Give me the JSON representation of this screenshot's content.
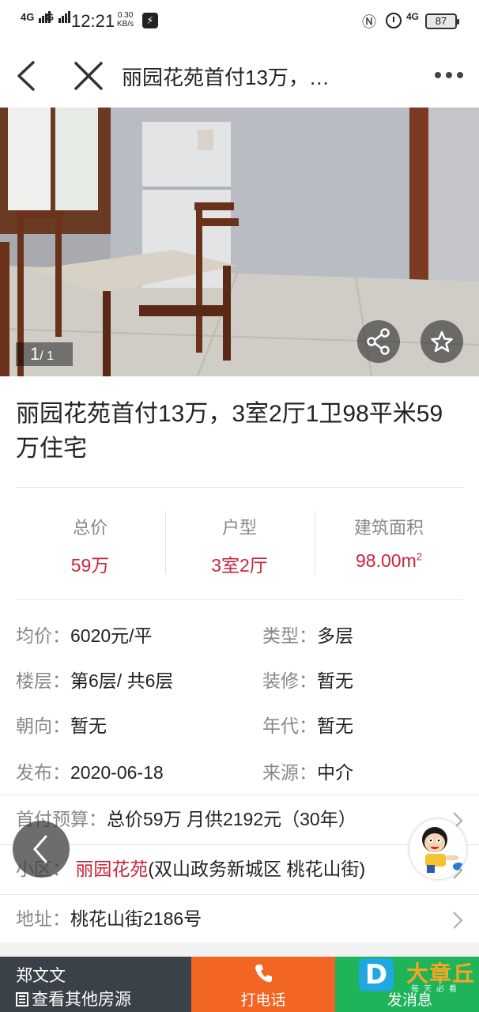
{
  "status_bar": {
    "signal1": "4G",
    "signal2": "G",
    "time": "12:21",
    "speed_value": "0.30",
    "speed_unit": "KB/s",
    "network": "4G",
    "battery": "87"
  },
  "nav": {
    "title": "丽园花苑首付13万，…"
  },
  "photo": {
    "current": "1",
    "total": "/ 1"
  },
  "listing": {
    "title": "丽园花苑首付13万，3室2厅1卫98平米59万住宅"
  },
  "stats": [
    {
      "label": "总价",
      "value": "59万"
    },
    {
      "label": "户型",
      "value": "3室2厅"
    },
    {
      "label": "建筑面积",
      "value": "98.00m",
      "unit_sup": "2"
    }
  ],
  "attributes": {
    "unit_price": {
      "key": "均价：",
      "value": "6020元/平"
    },
    "type": {
      "key": "类型：",
      "value": "多层"
    },
    "floor": {
      "key": "楼层：",
      "value": "第6层/ 共6层"
    },
    "decoration": {
      "key": "装修：",
      "value": "暂无"
    },
    "orientation": {
      "key": "朝向：",
      "value": "暂无"
    },
    "year": {
      "key": "年代：",
      "value": "暂无"
    },
    "published": {
      "key": "发布：",
      "value": "2020-06-18"
    },
    "source": {
      "key": "来源：",
      "value": "中介"
    }
  },
  "rows": {
    "budget": {
      "key": "首付预算：",
      "value": "总价59万 月供2192元（30年）"
    },
    "community": {
      "key": "小区：",
      "name": "丽园花苑",
      "detail": "(双山政务新城区 桃花山街)"
    },
    "address": {
      "key": "地址：",
      "value": "桃花山街2186号"
    }
  },
  "bottom_bar": {
    "agent_name": "郑文文",
    "agent_more": "查看其他房源",
    "call_label": "打电话",
    "message_label": "发消息"
  },
  "watermark": {
    "letter": "D",
    "text": "大章丘",
    "sub": "每天必看"
  },
  "colors": {
    "accent_red": "#c8253b",
    "call_orange": "#f26522",
    "message_green": "#1fb35a",
    "agent_dark": "#3b4148"
  }
}
